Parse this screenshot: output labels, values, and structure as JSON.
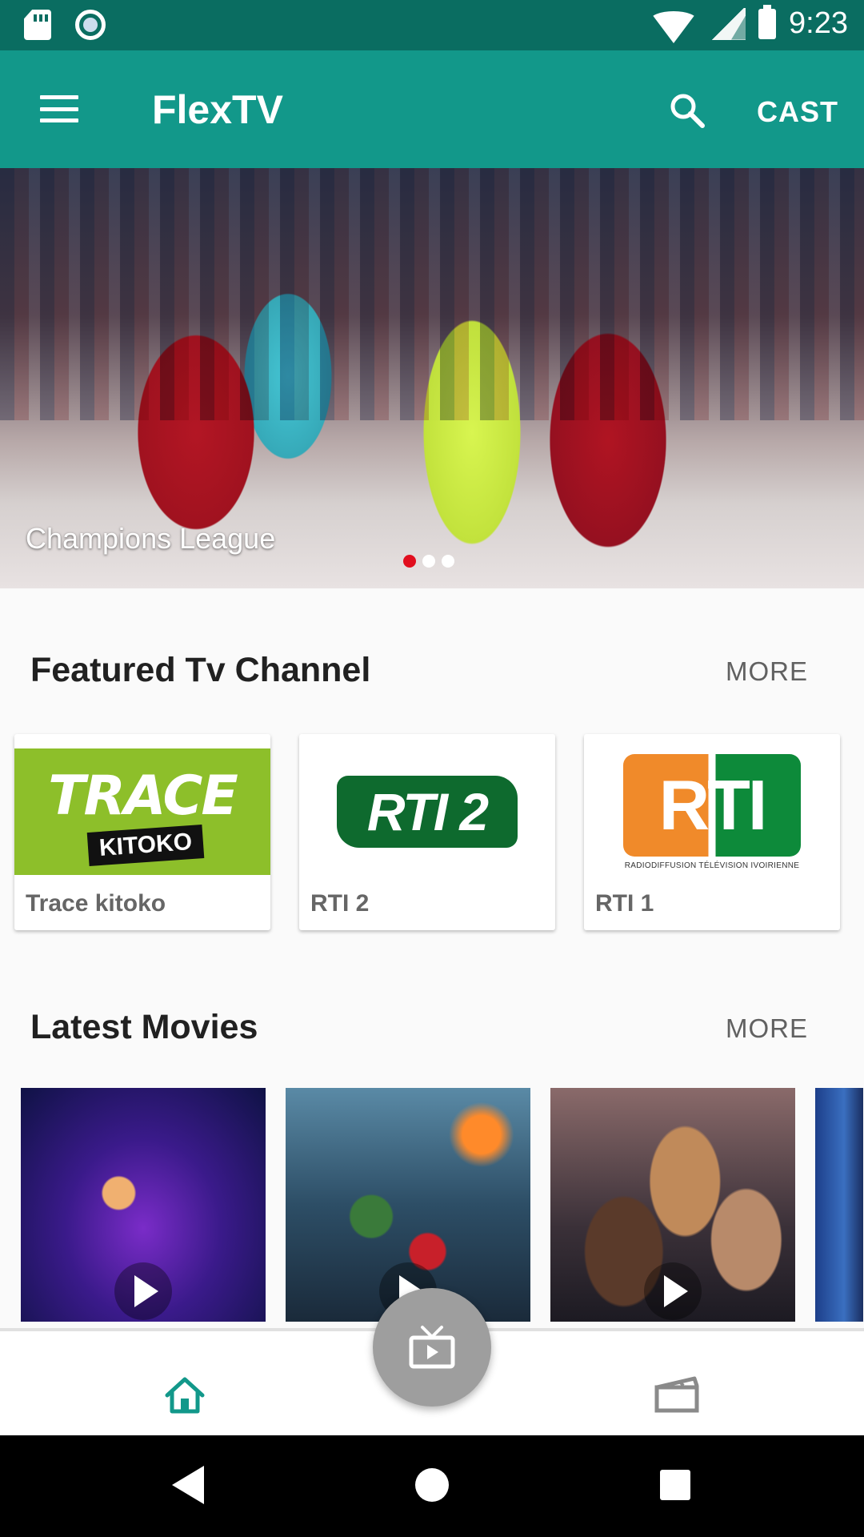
{
  "status_bar": {
    "time": "9:23",
    "left_icons": [
      "sd-card-icon",
      "sync-circle-icon"
    ],
    "right_icons": [
      "wifi-icon",
      "signal-icon",
      "battery-icon"
    ]
  },
  "app_bar": {
    "title": "FlexTV",
    "menu_icon": "menu-icon",
    "search_icon": "search-icon",
    "cast_label": "CAST",
    "background_color": "#12988a"
  },
  "hero": {
    "caption": "Champions League",
    "slide_count": 3,
    "active_slide": 1,
    "active_dot_color": "#e10e1e"
  },
  "featured": {
    "title": "Featured Tv Channel",
    "more_label": "MORE",
    "channels": [
      {
        "name": "Trace kitoko",
        "logo_text": "TRACE",
        "logo_subtext": "KITOKO"
      },
      {
        "name": "RTI 2",
        "logo_text": "RTI 2"
      },
      {
        "name": "RTI 1",
        "logo_text": "RTI",
        "logo_subtext": "RADIODIFFUSION TÉLÉVISION IVOIRIENNE"
      }
    ]
  },
  "latest_movies": {
    "title": "Latest Movies",
    "more_label": "MORE",
    "play_icon": "play-icon"
  },
  "bottom_nav": {
    "items": [
      "home-icon",
      "tv-icon",
      "movies-icon"
    ],
    "active_item": "home-icon",
    "active_color": "#12988a",
    "inactive_color": "#8a8a8a"
  },
  "system_nav": {
    "buttons": [
      "back-icon",
      "home-circle-icon",
      "recents-icon"
    ]
  }
}
